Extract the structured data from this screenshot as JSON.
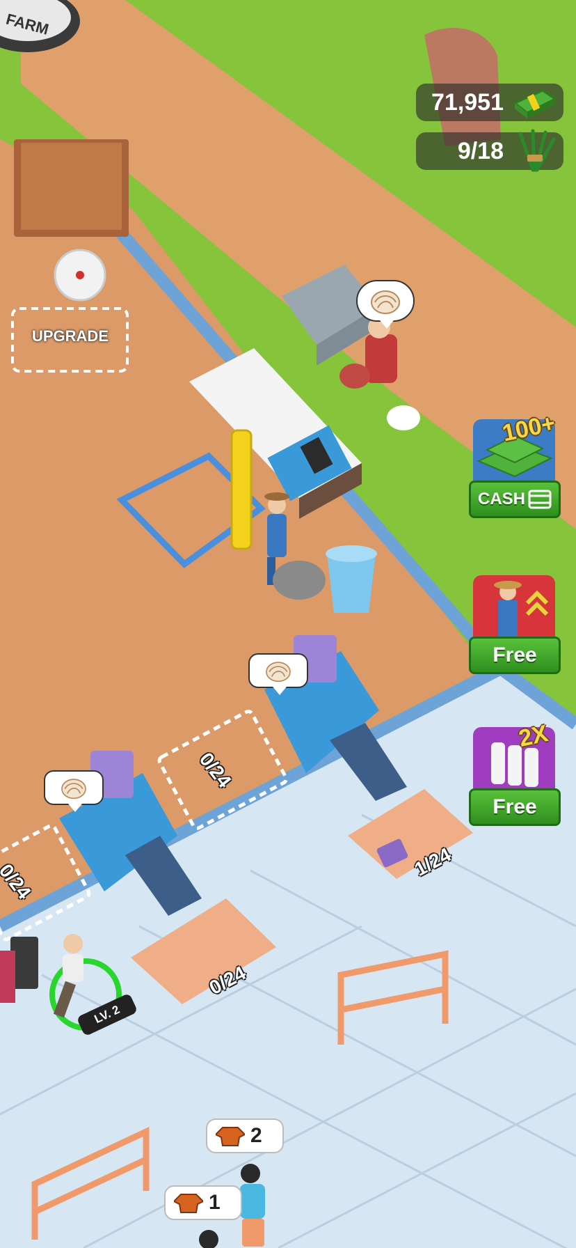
{
  "hud": {
    "money": "71,951",
    "grass": "9/18",
    "money_icon": "cash-stack-icon",
    "grass_icon": "grass-bundle-icon"
  },
  "farm_sign": "FARM",
  "upgrade_label": "UPGRADE",
  "side_buttons": {
    "cash": {
      "badge": "100+",
      "label": "CASH",
      "icon": "video-ad-icon"
    },
    "worker": {
      "label": "Free"
    },
    "milk": {
      "badge": "2X",
      "label": "Free"
    }
  },
  "stations": {
    "pad_left_counter": "0/24",
    "pad_mid_counter": "0/24",
    "output_left_counter": "0/24",
    "output_right_counter": "1/24"
  },
  "player": {
    "level": "LV. 2"
  },
  "customers": {
    "order_1_count": "2",
    "order_2_count": "1"
  },
  "colors": {
    "grass": "#86c43c",
    "dirt": "#e2a472",
    "floor": "#d6e6f2",
    "button_green": "#3da52a",
    "machine_blue": "#3a9ad9"
  }
}
